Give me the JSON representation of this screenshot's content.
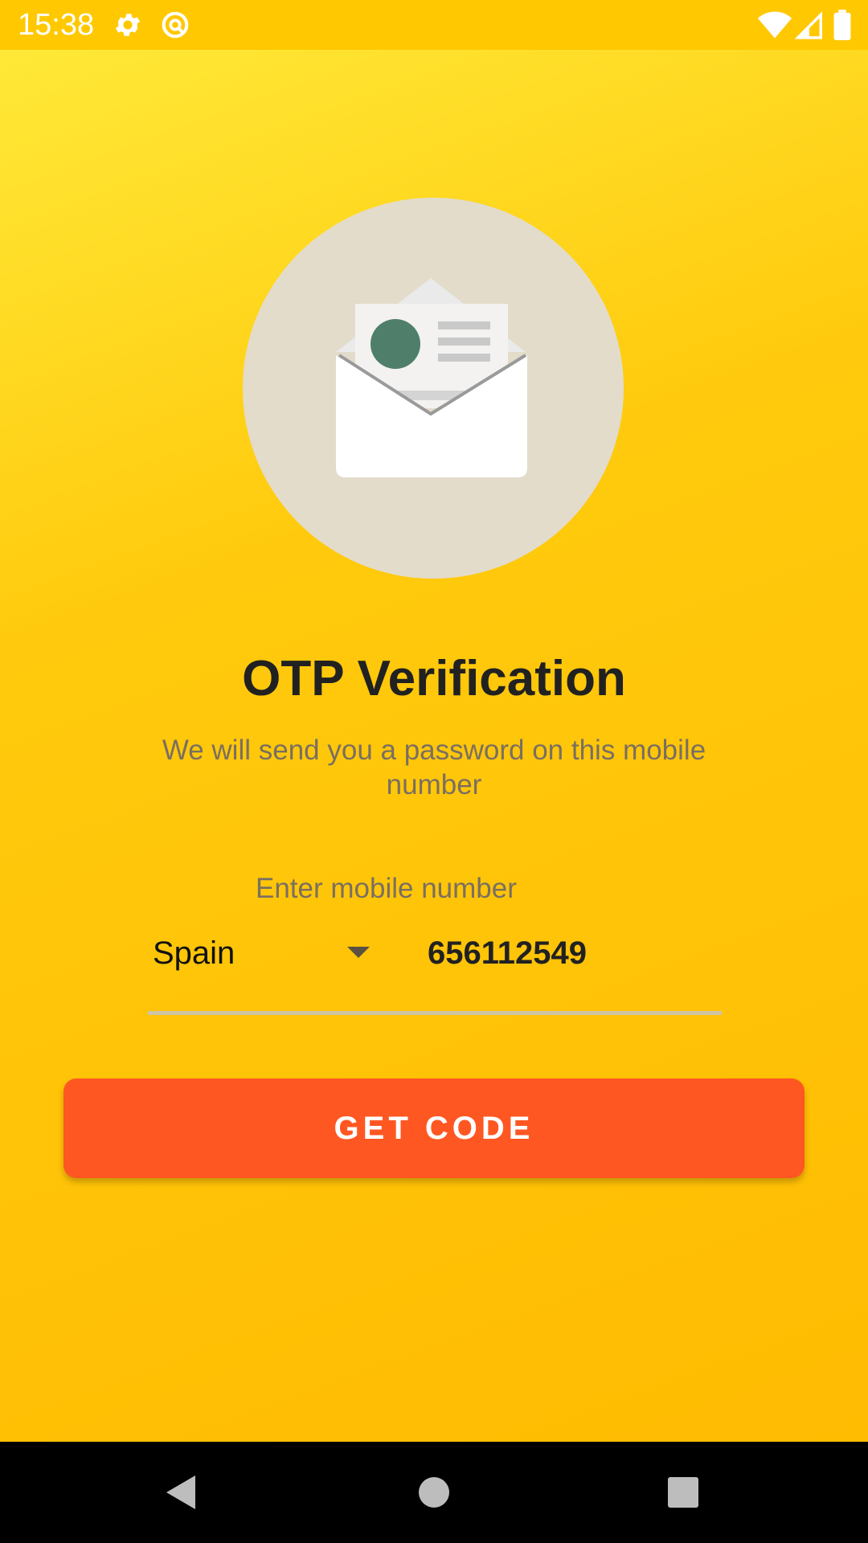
{
  "status_bar": {
    "time": "15:38",
    "icons": [
      "gear-icon",
      "data-saver-icon",
      "wifi-icon",
      "signal-icon",
      "battery-icon"
    ]
  },
  "illustration": {
    "icon": "open-envelope-icon",
    "circle_color": "#E3DCCB"
  },
  "main": {
    "title": "OTP Verification",
    "subtitle": "We will send you a password on this mobile number",
    "input_label": "Enter mobile number",
    "country": "Spain",
    "phone_value": "656112549",
    "button_label": "GET CODE"
  },
  "nav_bar": {
    "icons": [
      "back-icon",
      "home-icon",
      "recents-icon"
    ]
  },
  "colors": {
    "background_top": "#FFEB3B",
    "background_bottom": "#FFBA00",
    "status_bar": "#FFC800",
    "button": "#FF5722",
    "title": "#212121",
    "secondary_text": "#7A6F60"
  }
}
